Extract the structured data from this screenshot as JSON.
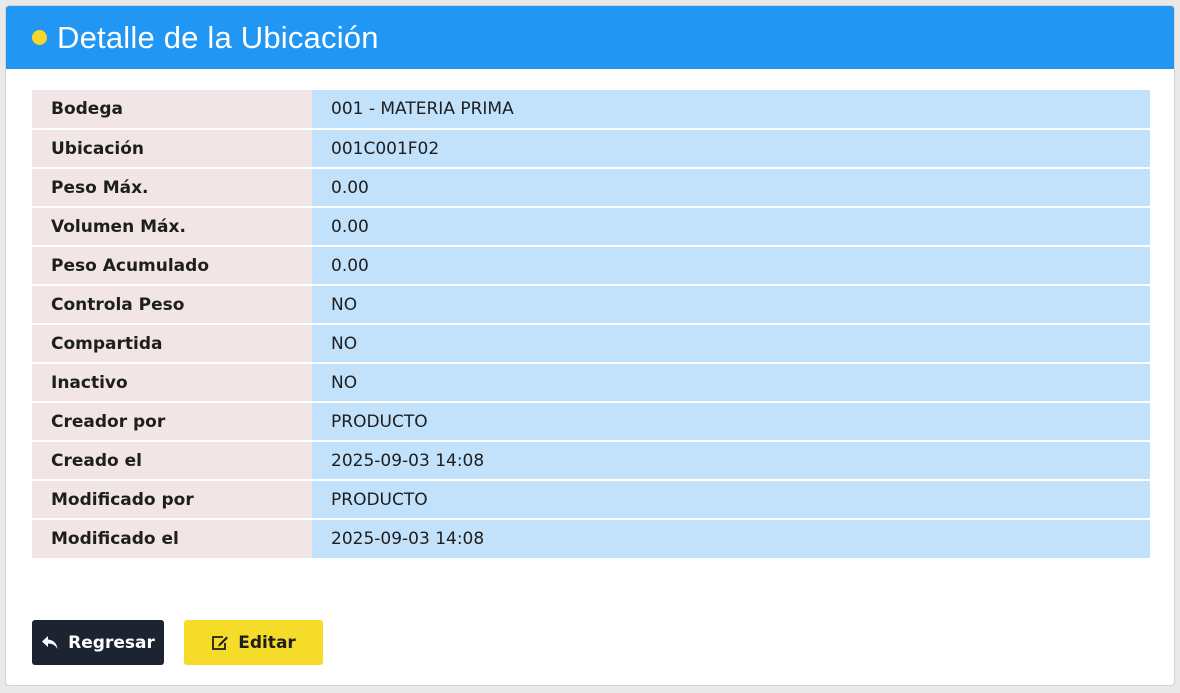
{
  "header": {
    "title": "Detalle de la Ubicación",
    "accent_color": "#2196f3",
    "dot_color": "#f7d531"
  },
  "details": [
    {
      "label": "Bodega",
      "value": "001 - MATERIA PRIMA"
    },
    {
      "label": "Ubicación",
      "value": "001C001F02"
    },
    {
      "label": "Peso Máx.",
      "value": "0.00"
    },
    {
      "label": "Volumen Máx.",
      "value": "0.00"
    },
    {
      "label": "Peso Acumulado",
      "value": "0.00"
    },
    {
      "label": "Controla Peso",
      "value": "NO"
    },
    {
      "label": "Compartida",
      "value": "NO"
    },
    {
      "label": "Inactivo",
      "value": "NO"
    },
    {
      "label": "Creador por",
      "value": "PRODUCTO"
    },
    {
      "label": "Creado el",
      "value": "2025-09-03 14:08"
    },
    {
      "label": "Modificado por",
      "value": "PRODUCTO"
    },
    {
      "label": "Modificado el",
      "value": "2025-09-03 14:08"
    }
  ],
  "actions": {
    "back_label": "Regresar",
    "back_icon": "reply-icon",
    "edit_label": "Editar",
    "edit_icon": "edit-icon"
  }
}
